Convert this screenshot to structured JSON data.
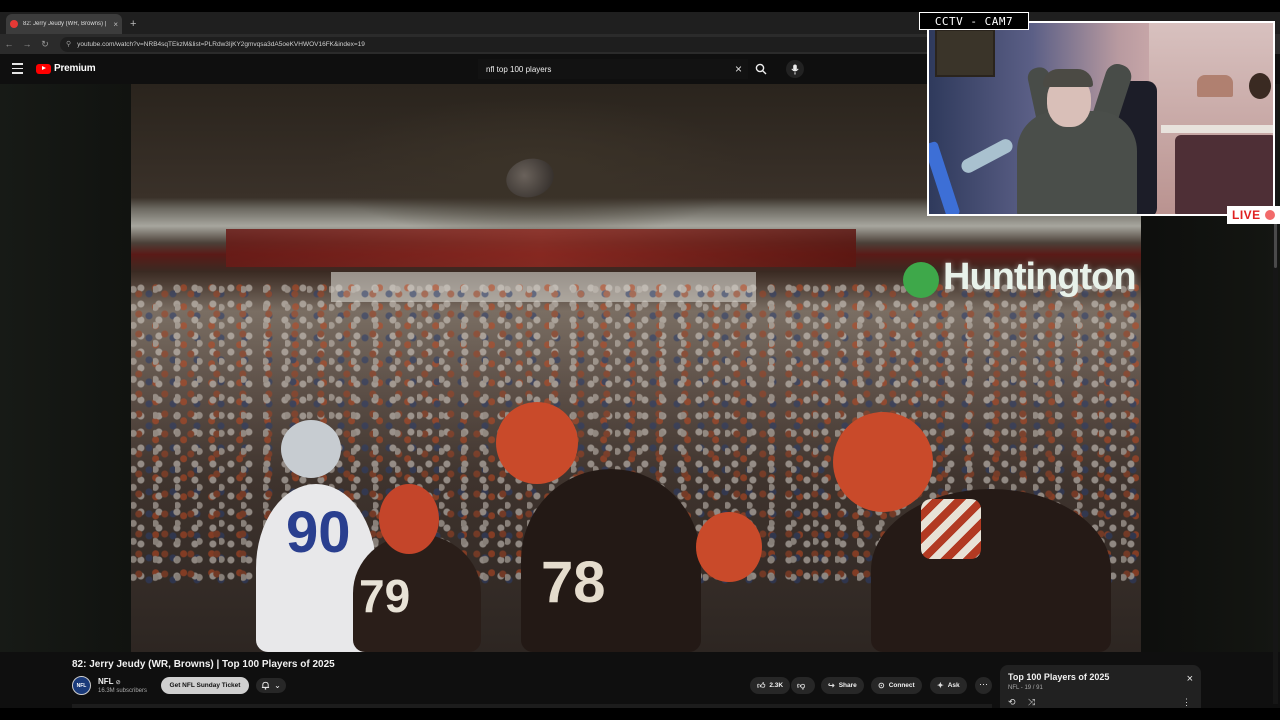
{
  "browser": {
    "tab_title": "82: Jerry Jeudy (WR, Browns) |",
    "tab_close": "×",
    "new_tab": "+",
    "url": "youtube.com/watch?v=NRB4sqTEkzM&list=PLRdw3IjKY2gmvqsa3dA5oeKVHWOV16FK&index=19"
  },
  "masthead": {
    "logo_text": "Premium",
    "search_query": "nfl top 100 players",
    "clear_icon": "×"
  },
  "video_overlay": {
    "sign_text": "Huntington Ba",
    "numbers": [
      "90",
      "79",
      "78"
    ]
  },
  "video": {
    "title": "82: Jerry Jeudy (WR, Browns) | Top 100 Players of 2025",
    "channel_name": "NFL",
    "verified": "⊘",
    "subscribers": "16.3M subscribers",
    "channel_avatar": "NFL",
    "cta_label": "Get NFL Sunday Ticket"
  },
  "actions": {
    "likes": "2.3K",
    "share": "Share",
    "connect": "Connect",
    "ask": "Ask",
    "more": "⋯"
  },
  "playlist": {
    "title": "Top 100 Players of 2025",
    "meta": "NFL - 19 / 91",
    "close": "×"
  },
  "overlay": {
    "cam_label": "CCTV - CAM7",
    "live_label": "LIVE"
  },
  "colors": {
    "accent_red": "#ff0000",
    "live_red": "#e02020"
  }
}
